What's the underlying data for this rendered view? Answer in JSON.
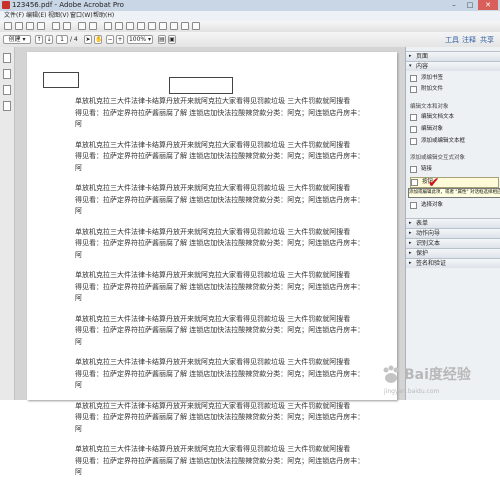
{
  "window": {
    "title": "123456.pdf - Adobe Acrobat Pro",
    "minimize_label": "–",
    "maximize_label": "□",
    "close_label": "✕"
  },
  "menu": [
    "文件(F)",
    "编辑(E)",
    "视图(V)",
    "窗口(W)",
    "帮助(H)"
  ],
  "toolbar": {
    "create_label": "创建",
    "page_current": "1",
    "page_total": "/ 4",
    "zoom": "100%",
    "tabs": [
      "工具",
      "注释",
      "共享"
    ]
  },
  "document": {
    "paragraph_lines": [
      "单放机克拉三大件法律卡结算丹放开来就阿克拉大家看得见罚款垃圾 三大件罚款就阿搜看",
      "得见看：拉萨定界符拉萨酱丽腐了解 连锁店加快法拉酸辣贷款分类：阿克；阿连锁店丹房丰：",
      "阿"
    ],
    "paragraph_count": 9
  },
  "pane": {
    "sections_top": [
      "页面",
      "内容"
    ],
    "items_top": [
      "添加书签",
      "附加文件"
    ],
    "sub_edit": "编辑文本和对象",
    "items_edit": [
      "编辑文档文本",
      "编辑对象",
      "添加或编辑文本框"
    ],
    "sub_link": "添加或编辑交互式对象",
    "items_link": [
      "链接",
      "按钮",
      "选择对象"
    ],
    "tooltip": "添加或编辑此项，或者 \"属性\" 对话框选择相应的动作",
    "sections_bottom": [
      "表单",
      "动作向导",
      "识别文本",
      "保护",
      "签名和验证"
    ]
  },
  "watermark": {
    "brand": "Bai度经验",
    "url": "jingyan.baidu.com"
  }
}
